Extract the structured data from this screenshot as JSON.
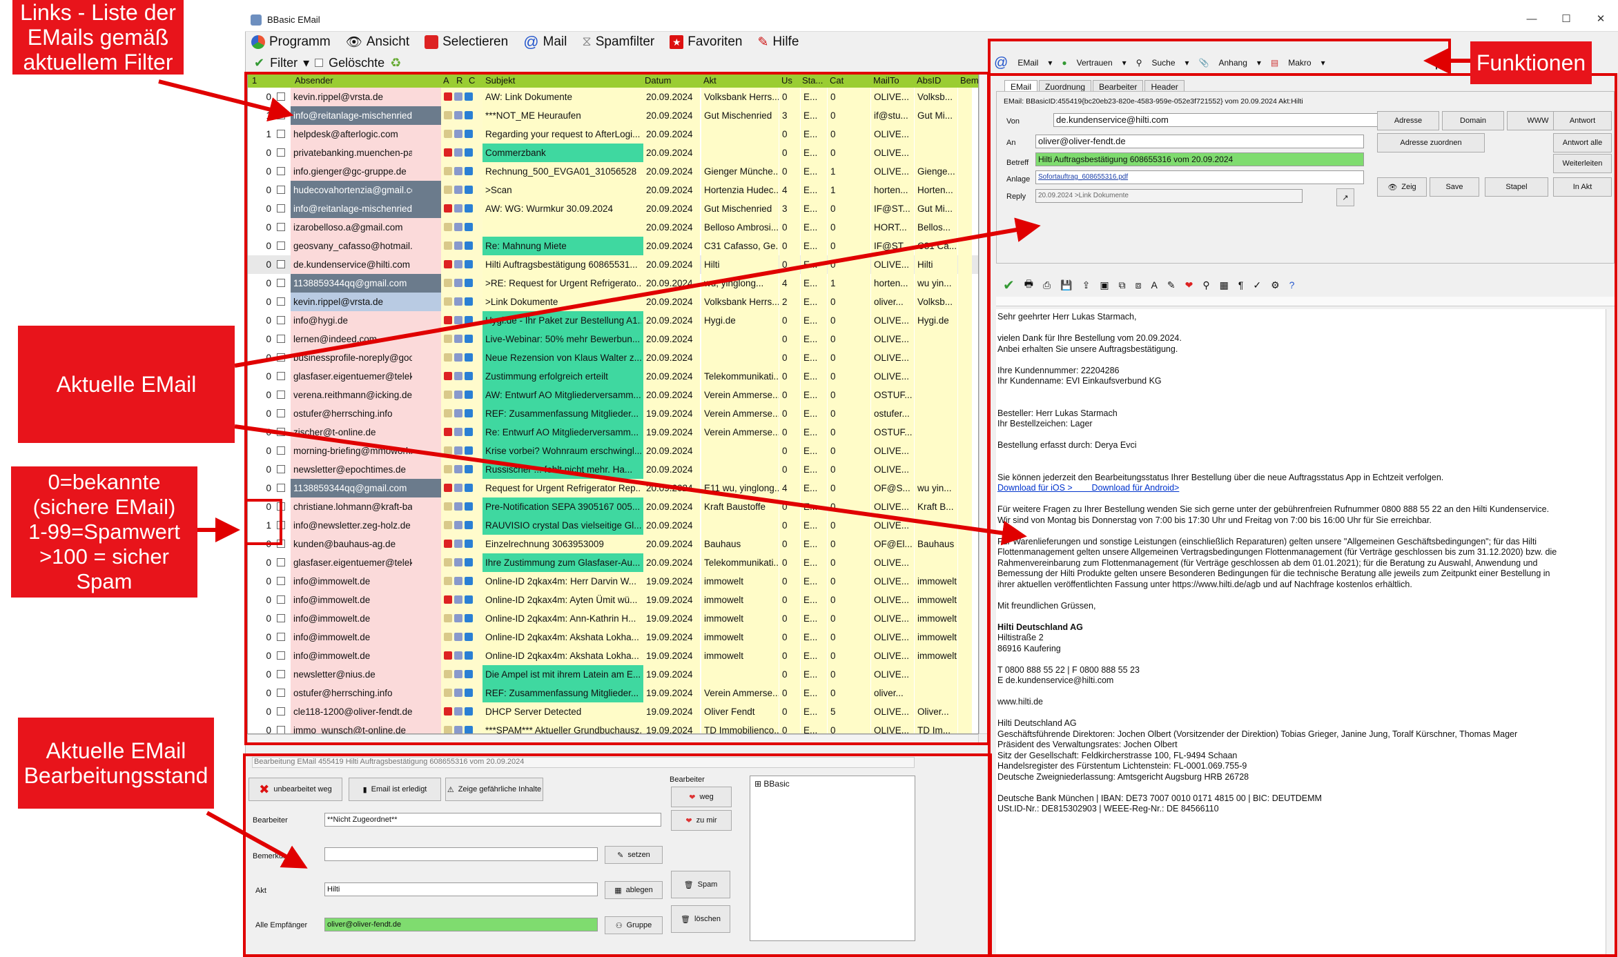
{
  "window": {
    "title": "BBasic EMail",
    "min": "—",
    "max": "☐",
    "close": "✕"
  },
  "menu": [
    "Programm",
    "Ansicht",
    "Selectieren",
    "Mail",
    "Spamfilter",
    "Favoriten",
    "Hilfe"
  ],
  "filter": {
    "label": "Filter",
    "deleted": "Gelöschte"
  },
  "grid_headers": [
    "1",
    "Absender",
    "A",
    "R",
    "C",
    "Subjekt",
    "Datum",
    "Akt",
    "Us",
    "Sta...",
    "Cat",
    "MailTo",
    "AbsID",
    "Bem"
  ],
  "rows": [
    [
      "0",
      "kevin.rippel@vrsta.de",
      "AW: Link Dokumente",
      "20.09.2024",
      "Volksbank Herrs...",
      "0",
      "E...",
      "0",
      "OLIVE...",
      "Volksb..."
    ],
    [
      "1",
      "info@reitanlage-mischenried.de",
      "***NOT_ME Heuraufen",
      "20.09.2024",
      "Gut Mischenried",
      "3",
      "E...",
      "0",
      "if@stu...",
      "Gut Mi..."
    ],
    [
      "1",
      "helpdesk@afterlogic.com",
      "Regarding your request to AfterLogi...",
      "20.09.2024",
      "",
      "0",
      "E...",
      "0",
      "OLIVE...",
      ""
    ],
    [
      "0",
      "privatebanking.muenchen-pasing...",
      "Commerzbank",
      "20.09.2024",
      "",
      "0",
      "E...",
      "0",
      "OLIVE...",
      ""
    ],
    [
      "0",
      "info.gienger@gc-gruppe.de",
      "Rechnung_500_EVGA01_31056528",
      "20.09.2024",
      "Gienger Münche...",
      "0",
      "E...",
      "1",
      "OLIVE...",
      "Gienge..."
    ],
    [
      "0",
      "hudecovahortenzia@gmail.com",
      ">Scan",
      "20.09.2024",
      "Hortenzia Hudec...",
      "4",
      "E...",
      "1",
      "horten...",
      "Horten..."
    ],
    [
      "0",
      "info@reitanlage-mischenried.de",
      "AW: WG: Wurmkur 30.09.2024",
      "20.09.2024",
      "Gut Mischenried",
      "3",
      "E...",
      "0",
      "IF@ST...",
      "Gut Mi..."
    ],
    [
      "0",
      "izarobelloso.a@gmail.com",
      "",
      "20.09.2024",
      "Belloso Ambrosi...",
      "0",
      "E...",
      "0",
      "HORT...",
      "Bellos..."
    ],
    [
      "0",
      "geosvany_cafasso@hotmail.de",
      "Re: Mahnung Miete",
      "20.09.2024",
      "C31 Cafasso, Ge...",
      "0",
      "E...",
      "0",
      "IF@ST...",
      "C31 Ca..."
    ],
    [
      "0",
      "de.kundenservice@hilti.com",
      "Hilti Auftragsbestätigung 60865531...",
      "20.09.2024",
      "Hilti",
      "0",
      "E...",
      "0",
      "OLIVE...",
      "Hilti"
    ],
    [
      "0",
      "1138859344qq@gmail.com",
      ">RE: Request for Urgent Refrigerato...",
      "20.09.2024",
      "wu, yinglong...",
      "4",
      "E...",
      "1",
      "horten...",
      "wu yin..."
    ],
    [
      "0",
      "kevin.rippel@vrsta.de",
      ">Link Dokumente",
      "20.09.2024",
      "Volksbank Herrs...",
      "2",
      "E...",
      "0",
      "oliver...",
      "Volksb..."
    ],
    [
      "0",
      "info@hygi.de",
      "Hygi.de - Ihr Paket zur Bestellung A1...",
      "20.09.2024",
      "Hygi.de",
      "0",
      "E...",
      "0",
      "OLIVE...",
      "Hygi.de"
    ],
    [
      "0",
      "lernen@indeed.com",
      "Live-Webinar: 50% mehr Bewerbun...",
      "20.09.2024",
      "",
      "0",
      "E...",
      "0",
      "OLIVE...",
      ""
    ],
    [
      "0",
      "businessprofile-noreply@google...",
      "Neue Rezension von Klaus Walter z...",
      "20.09.2024",
      "",
      "0",
      "E...",
      "0",
      "OLIVE...",
      ""
    ],
    [
      "0",
      "glasfaser.eigentuemer@telekom.de",
      "Zustimmung erfolgreich erteilt",
      "20.09.2024",
      "Telekommunikati...",
      "0",
      "E...",
      "0",
      "OLIVE...",
      ""
    ],
    [
      "0",
      "verena.reithmann@icking.de",
      "AW: Entwurf AO Mitgliederversamm...",
      "20.09.2024",
      "Verein Ammerse...",
      "0",
      "E...",
      "0",
      "OSTUF...",
      ""
    ],
    [
      "0",
      "ostufer@herrsching.info",
      "REF: Zusammenfassung Mitglieder...",
      "19.09.2024",
      "Verein Ammerse...",
      "0",
      "E...",
      "0",
      "ostufer...",
      ""
    ],
    [
      "0",
      "zischer@t-online.de",
      "Re: Entwurf AO Mitgliederversamm...",
      "19.09.2024",
      "Verein Ammerse...",
      "0",
      "E...",
      "0",
      "OSTUF...",
      ""
    ],
    [
      "0",
      "morning-briefing@mmowork...",
      "Krise vorbei? Wohnraum erschwingl...",
      "20.09.2024",
      "",
      "0",
      "E...",
      "0",
      "OLIVE...",
      ""
    ],
    [
      "0",
      "newsletter@epochtimes.de",
      "Russischer ... fehlt nicht mehr. Ha...",
      "20.09.2024",
      "",
      "0",
      "E...",
      "0",
      "OLIVE...",
      ""
    ],
    [
      "0",
      "1138859344qq@gmail.com",
      "Request for Urgent Refrigerator Rep...",
      "20.09.2024",
      "E11 wu, yinglong...",
      "4",
      "E...",
      "0",
      "OF@S...",
      "wu yin..."
    ],
    [
      "0",
      "christiane.lohmann@kraft-baust...",
      "Pre-Notification SEPA 3905167 005...",
      "20.09.2024",
      "Kraft Baustoffe",
      "0",
      "E...",
      "0",
      "OLIVE...",
      "Kraft B..."
    ],
    [
      "1",
      "info@newsletter.zeg-holz.de",
      "RAUVISIO crystal  Das vielseitige Gl...",
      "20.09.2024",
      "",
      "0",
      "E...",
      "0",
      "OLIVE...",
      ""
    ],
    [
      "0",
      "kunden@bauhaus-ag.de",
      "Einzelrechnung 3063953009",
      "20.09.2024",
      "Bauhaus",
      "0",
      "E...",
      "0",
      "OF@El...",
      "Bauhaus"
    ],
    [
      "0",
      "glasfaser.eigentuemer@telekom.de",
      "Ihre Zustimmung zum Glasfaser-Au...",
      "20.09.2024",
      "Telekommunikati...",
      "0",
      "E...",
      "0",
      "OLIVE...",
      ""
    ],
    [
      "0",
      "info@immowelt.de",
      "Online-ID 2qkax4m: Herr Darvin W...",
      "19.09.2024",
      "immowelt",
      "0",
      "E...",
      "0",
      "OLIVE...",
      "immowelt"
    ],
    [
      "0",
      "info@immowelt.de",
      "Online-ID 2qkax4m: Ayten Ümit wü...",
      "19.09.2024",
      "immowelt",
      "0",
      "E...",
      "0",
      "OLIVE...",
      "immowelt"
    ],
    [
      "0",
      "info@immowelt.de",
      "Online-ID 2qkax4m:  Ann-Kathrin H...",
      "19.09.2024",
      "immowelt",
      "0",
      "E...",
      "0",
      "OLIVE...",
      "immowelt"
    ],
    [
      "0",
      "info@immowelt.de",
      "Online-ID 2qkax4m: Akshata Lokha...",
      "19.09.2024",
      "immowelt",
      "0",
      "E...",
      "0",
      "OLIVE...",
      "immowelt"
    ],
    [
      "0",
      "info@immowelt.de",
      "Online-ID 2qkax4m: Akshata Lokha...",
      "19.09.2024",
      "immowelt",
      "0",
      "E...",
      "0",
      "OLIVE...",
      "immowelt"
    ],
    [
      "0",
      "newsletter@nius.de",
      "Die Ampel ist mit ihrem Latein am E...",
      "19.09.2024",
      "",
      "0",
      "E...",
      "0",
      "OLIVE...",
      ""
    ],
    [
      "0",
      "ostufer@herrsching.info",
      "REF: Zusammenfassung Mitglieder...",
      "19.09.2024",
      "Verein Ammerse...",
      "0",
      "E...",
      "0",
      "oliver...",
      ""
    ],
    [
      "0",
      "cle118-1200@oliver-fendt.de",
      "DHCP Server Detected",
      "19.09.2024",
      "Oliver Fendt",
      "0",
      "E...",
      "5",
      "OLIVE...",
      "Oliver..."
    ],
    [
      "0",
      "immo_wunsch@t-online.de",
      "***SPAM*** Aktueller Grundbuchausz...",
      "19.09.2024",
      "TD Immobilienco...",
      "0",
      "E...",
      "0",
      "OLIVE...",
      "TD Im..."
    ]
  ],
  "bottom": {
    "caption": "Bearbeitung EMail 455419 Hilti Auftragsbestätigung 608655316 vom 20.09.2024",
    "btn_unbearbeitet": "unbearbeitet weg",
    "btn_erledigt": "Email ist erledigt",
    "btn_gefaehrlich": "Zeige gefährliche Inhalte",
    "bearbeiter_label": "Bearbeiter",
    "bearbeiter_value": "**Nicht Zugeordnet**",
    "bemerkung_label": "Bemerkung",
    "setzen": "setzen",
    "akt_label": "Akt",
    "akt_value": "Hilti",
    "ablegen": "ablegen",
    "empf_label": "Alle Empfänger",
    "empf_value": "oliver@oliver-fendt.de",
    "gruppe": "Gruppe",
    "bearbeiter_group": "Bearbeiter",
    "weg": "weg",
    "zu_mir": "zu mir",
    "spam": "Spam",
    "loeschen": "löschen",
    "tree_root": "BBasic"
  },
  "rtoolbar": [
    "EMail",
    "Vertrauen",
    "Suche",
    "Anhang",
    "Makro"
  ],
  "tabs": [
    "EMail",
    "Zuordnung",
    "Bearbeiter",
    "Header"
  ],
  "header": {
    "info": "EMail: BBasicID:455419{bc20eb23-820e-4583-959e-052e3f721552} vom 20.09.2024 Akt:Hilti",
    "von_label": "Von",
    "von": "de.kundenservice@hilti.com",
    "an_label": "An",
    "an": "oliver@oliver-fendt.de",
    "betreff_label": "Betreff",
    "betreff": "Hilti Auftragsbestätigung 608655316 vom 20.09.2024",
    "anlage_label": "Anlage",
    "anlage": "Sofortauftrag_608655316.pdf",
    "reply_label": "Reply",
    "reply": "20.09.2024 >Link Dokumente",
    "btns": [
      "Adresse",
      "Domain",
      "WWW",
      "Antwort",
      "Adresse zuordnen",
      "Antwort alle",
      "Weiterleiten",
      "Zeig",
      "Save",
      "Stapel",
      "In Akt"
    ]
  },
  "mail_body": [
    "Sehr geehrter Herr Lukas Starmach,",
    "",
    "vielen Dank für Ihre Bestellung vom 20.09.2024.",
    "Anbei erhalten Sie unsere Auftragsbestätigung.",
    "",
    "Ihre Kundennummer: 22204286",
    "Ihr Kundenname: EVI Einkaufsverbund KG",
    "",
    "",
    "Besteller: Herr Lukas Starmach",
    "Ihr Bestellzeichen: Lager",
    "",
    "Bestellung erfasst durch: Derya Evci",
    "",
    "",
    "Sie können jederzeit den Bearbeitungsstatus Ihrer Bestellung über die neue Auftragsstatus App in Echtzeit verfolgen.",
    "Download für iOS >        Download für Android>",
    "",
    "Für weitere Fragen zu Ihrer Bestellung wenden Sie sich gerne unter der gebührenfreien Rufnummer 0800 888 55 22 an den Hilti Kundenservice.",
    "Wir sind von Montag bis Donnerstag von 7:00 bis 17:30 Uhr und Freitag von 7:00 bis 16:00 Uhr für Sie erreichbar.",
    "",
    "Für Warenlieferungen und sonstige Leistungen (einschließlich Reparaturen) gelten unsere \"Allgemeinen Geschäftsbedingungen\"; für das Hilti",
    "Flottenmanagement gelten unsere Allgemeinen Vertragsbedingungen Flottenmanagement (für Verträge geschlossen bis zum 31.12.2020) bzw. die",
    "Rahmenvereinbarung zum Flottenmanagement (für Verträge geschlossen ab dem 01.01.2021); für die Beratung zu Auswahl, Anwendung und",
    "Bemessung der Hilti Produkte gelten unsere Besonderen Bedingungen für die technische Beratung alle jeweils zum Zeitpunkt einer Bestellung in",
    "ihrer aktuellen veröffentlichten Fassung unter https://www.hilti.de/agb und auf Nachfrage kostenlos erhältlich.",
    "",
    "Mit freundlichen Grüssen,",
    "",
    "Hilti Deutschland AG",
    "Hiltistraße 2",
    "86916 Kaufering",
    "",
    "T 0800 888 55 22 | F 0800 888 55 23",
    "E de.kundenservice@hilti.com",
    "",
    "www.hilti.de",
    "",
    "Hilti Deutschland AG",
    "Geschäftsführende Direktoren: Jochen Olbert (Vorsitzender der Direktion) Tobias Grieger, Janine Jung, Toralf Kürschner, Thomas Mager",
    "Präsident des Verwaltungsrates: Jochen Olbert",
    "Sitz der Gesellschaft: Feldkircherstrasse 100, FL-9494 Schaan",
    "Handelsregister des Fürstentum Lichtenstein: FL-0001.069.755-9",
    "Deutsche Zweigniederlassung: Amtsgericht Augsburg HRB 26728",
    "",
    "Deutsche Bank München | IBAN: DE73 7007 0010 0171 4815 00 | BIC: DEUTDEMM",
    "USt.ID-Nr.: DE815302903 | WEEE-Reg-Nr.: DE 84566110"
  ],
  "callouts": {
    "links": "Links - Liste der EMails gemäß aktuellem Filter",
    "funktionen": "Funktionen",
    "aktuelle": "Aktuelle EMail",
    "spam": "0=bekannte (sichere EMail) 1-99=Spamwert >100 = sicher Spam",
    "stand": "Aktuelle EMail Bearbeitungsstand"
  }
}
